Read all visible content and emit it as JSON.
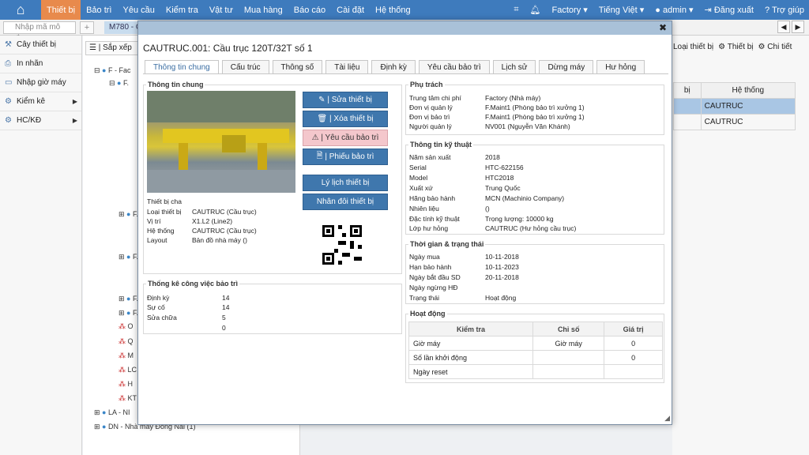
{
  "nav": {
    "menu": [
      "Thiết bị",
      "Bảo trì",
      "Yêu cầu",
      "Kiểm tra",
      "Vật tư",
      "Mua hàng",
      "Báo cáo",
      "Cài đặt",
      "Hệ thống"
    ],
    "factory": "Factory",
    "language": "Tiếng Việt",
    "user": "admin",
    "logout": "Đăng xuất",
    "help": "Trợ giúp"
  },
  "subbar": {
    "search_placeholder": "Nhập mã mô đun",
    "tab": "M780 - C"
  },
  "leftmenu": [
    {
      "label": "Cây thiết bị"
    },
    {
      "label": "In nhãn"
    },
    {
      "label": "Nhập giờ máy"
    },
    {
      "label": "Kiểm kê"
    },
    {
      "label": "HC/KĐ"
    }
  ],
  "mid": {
    "toolbar": "Sắp xếp",
    "tree": [
      "F - Fac",
      "F.",
      "F.",
      "F.",
      "F.",
      "F.",
      "F.",
      "O",
      "Q",
      "M",
      "LC",
      "H",
      "KT",
      "LA - NI",
      "DN - Nhà máy Đồng Nai (1)"
    ]
  },
  "right": {
    "links": [
      "Loại thiết bị",
      "Thiết bị",
      "Chi tiết"
    ],
    "col1": "bị",
    "col2": "Hệ thống",
    "rows": [
      "CAUTRUC",
      "CAUTRUC"
    ]
  },
  "modal": {
    "title": "CAUTRUC.001: Cầu trục 120T/32T số 1",
    "tabs": [
      "Thông tin chung",
      "Cấu trúc",
      "Thông số",
      "Tài liệu",
      "Định kỳ",
      "Yêu cầu bảo trì",
      "Lịch sử",
      "Dừng máy",
      "Hư hỏng"
    ],
    "general": {
      "title": "Thông tin chung",
      "labels": [
        "Thiết bị cha",
        "Loại thiết bị",
        "Vị trí",
        "Hệ thống",
        "Layout"
      ],
      "values": [
        "",
        "CAUTRUC (Cầu trục)",
        "X1.L2 (Line2)",
        "CAUTRUC (Cầu trục)",
        "Bản đồ nhà máy ()"
      ]
    },
    "buttons": [
      "| Sửa thiết bị",
      "| Xóa thiết bị",
      "| Yêu cầu bảo trì",
      "| Phiếu bảo trì",
      "Lý lịch thiết bị",
      "Nhân đôi thiết bị"
    ],
    "stats": {
      "title": "Thống kê công việc bảo trì",
      "labels": [
        "Định kỳ",
        "Sự cố",
        "Sửa chữa",
        ""
      ],
      "values": [
        "14",
        "14",
        "5",
        "0"
      ]
    },
    "resp": {
      "title": "Phụ trách",
      "labels": [
        "Trung tâm chi phí",
        "Đơn vị quản lý",
        "Đơn vị bảo trì",
        "Người quản lý"
      ],
      "values": [
        "Factory (Nhà máy)",
        "F.Maint1 (Phòng bảo trì xưởng 1)",
        "F.Maint1 (Phòng bảo trì xưởng 1)",
        "NV001 (Nguyễn Văn Khánh)"
      ]
    },
    "tech": {
      "title": "Thông tin kỹ thuật",
      "labels": [
        "Năm sản xuất",
        "Serial",
        "Model",
        "Xuất xứ",
        "Hãng bảo hành",
        "Nhiên liệu",
        "Đặc tính kỹ thuật",
        "Lớp hư hỏng"
      ],
      "values": [
        "2018",
        "HTC-622156",
        "HTC2018",
        "Trung Quốc",
        "MCN (Machinio Company)",
        "()",
        "Trọng lượng: 10000 kg",
        "CAUTRUC (Hư hỏng cầu trục)"
      ]
    },
    "time": {
      "title": "Thời gian & trạng thái",
      "labels": [
        "Ngày mua",
        "Hạn bảo hành",
        "Ngày bắt đầu SD",
        "Ngày ngừng HĐ",
        "Trạng thái"
      ],
      "values": [
        "10-11-2018",
        "10-11-2023",
        "20-11-2018",
        "",
        "Hoạt động"
      ]
    },
    "activity": {
      "title": "Hoạt động",
      "headers": [
        "Kiểm tra",
        "Chỉ số",
        "Giá trị"
      ],
      "rows": [
        [
          "Giờ máy",
          "Giờ máy",
          "0"
        ],
        [
          "Số lần khởi động",
          "",
          "0"
        ],
        [
          "Ngày reset",
          "",
          ""
        ]
      ]
    }
  }
}
